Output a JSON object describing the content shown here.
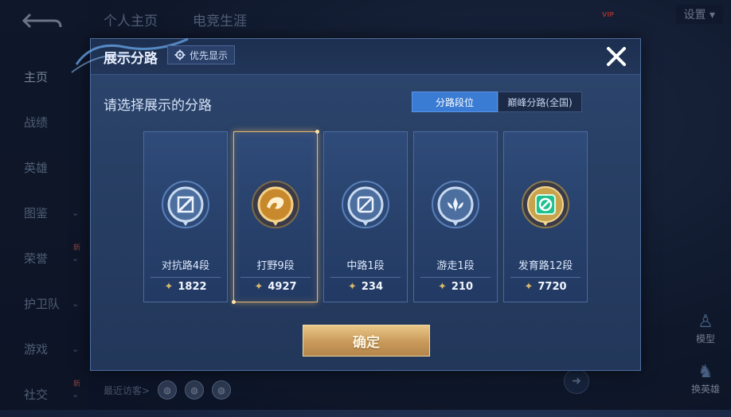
{
  "background": {
    "top_tabs": [
      "个人主页",
      "电竞生涯"
    ],
    "side_menu": [
      {
        "label": "主页",
        "active": true,
        "chevron": false,
        "new": false
      },
      {
        "label": "战绩",
        "active": false,
        "chevron": false,
        "new": false
      },
      {
        "label": "英雄",
        "active": false,
        "chevron": false,
        "new": false
      },
      {
        "label": "图鉴",
        "active": false,
        "chevron": true,
        "new": false
      },
      {
        "label": "荣誉",
        "active": false,
        "chevron": true,
        "new": true
      },
      {
        "label": "护卫队",
        "active": false,
        "chevron": true,
        "new": false
      },
      {
        "label": "游戏",
        "active": false,
        "chevron": true,
        "new": false
      },
      {
        "label": "社交",
        "active": false,
        "chevron": true,
        "new": true
      }
    ],
    "new_badge": "新",
    "vip_label": "VIP",
    "settings_label": "设置",
    "visitors_label": "最近访客>",
    "model_label": "模型",
    "swap_hero_label": "换英雄"
  },
  "modal": {
    "title": "展示分路",
    "priority_label": "优先显示",
    "prompt": "请选择展示的分路",
    "toggle": {
      "active": "分路段位",
      "inactive": "巅峰分路(全国)"
    },
    "cards": [
      {
        "name": "对抗路4段",
        "points": "1822",
        "emblem": "sword-emblem-icon",
        "color": "#8fb3d9",
        "selected": false
      },
      {
        "name": "打野9段",
        "points": "4927",
        "emblem": "dragon-emblem-icon",
        "color": "#d9a441",
        "selected": true
      },
      {
        "name": "中路1段",
        "points": "234",
        "emblem": "mage-emblem-icon",
        "color": "#8fb3d9",
        "selected": false
      },
      {
        "name": "游走1段",
        "points": "210",
        "emblem": "wing-emblem-icon",
        "color": "#8fb3d9",
        "selected": false
      },
      {
        "name": "发育路12段",
        "points": "7720",
        "emblem": "marksman-emblem-icon",
        "color": "#2fd0a0",
        "selected": false
      }
    ],
    "confirm_label": "确定"
  }
}
